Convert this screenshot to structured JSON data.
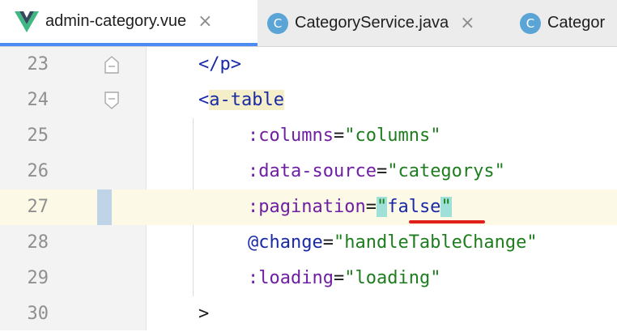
{
  "tabs": [
    {
      "label": "admin-category.vue",
      "icon": "vue-icon",
      "active": true,
      "closable": true
    },
    {
      "label": "CategoryService.java",
      "icon": "class-icon",
      "icon_letter": "C",
      "active": false,
      "closable": true
    },
    {
      "label": "Categor",
      "icon": "class-icon",
      "icon_letter": "C",
      "active": false,
      "closable": false
    }
  ],
  "close_glyph": "×",
  "lines": [
    {
      "number": "23",
      "parts": [
        "</",
        "p",
        ">"
      ]
    },
    {
      "number": "24",
      "parts": [
        "<",
        "a-table"
      ]
    },
    {
      "number": "25",
      "parts": [
        ":columns",
        "=",
        "\"",
        "columns",
        "\""
      ]
    },
    {
      "number": "26",
      "parts": [
        ":data-source",
        "=",
        "\"",
        "categorys",
        "\""
      ]
    },
    {
      "number": "27",
      "parts": [
        ":pagination",
        "=",
        "\"",
        "false",
        "\""
      ],
      "current": true
    },
    {
      "number": "28",
      "parts": [
        "@change",
        "=",
        "\"",
        "handleTableChange",
        "\""
      ]
    },
    {
      "number": "29",
      "parts": [
        ":loading",
        "=",
        "\"",
        "loading",
        "\""
      ]
    },
    {
      "number": "30",
      "parts": [
        ">"
      ]
    }
  ],
  "colors": {
    "tag": "#1a29a6",
    "attribute": "#6e1fa3",
    "string": "#1e7d1e",
    "current_line": "#fcfae7",
    "active_tab_underline": "#4c8bf5",
    "error_underline": "#e0201a"
  }
}
